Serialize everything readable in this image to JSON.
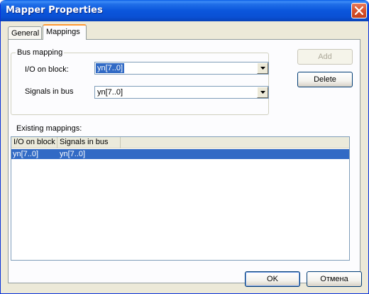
{
  "window": {
    "title": "Mapper Properties"
  },
  "tabs": [
    {
      "label": "General",
      "active": false
    },
    {
      "label": "Mappings",
      "active": true
    }
  ],
  "bus_mapping": {
    "group_label": "Bus mapping",
    "io_label": "I/O on block:",
    "io_value": "yn[7..0]",
    "signals_label": "Signals in bus",
    "signals_value": "yn[7..0]"
  },
  "buttons": {
    "add": "Add",
    "delete": "Delete",
    "ok": "OK",
    "cancel": "Отмена"
  },
  "existing": {
    "label": "Existing mappings:",
    "columns": [
      "I/O on block",
      "Signals in bus"
    ],
    "rows": [
      [
        "yn[7..0]",
        "yn[7..0]"
      ]
    ]
  },
  "colors": {
    "selection": "#316ac5",
    "titlebar": "#0b56dc",
    "dialog_bg": "#ece9d8"
  }
}
